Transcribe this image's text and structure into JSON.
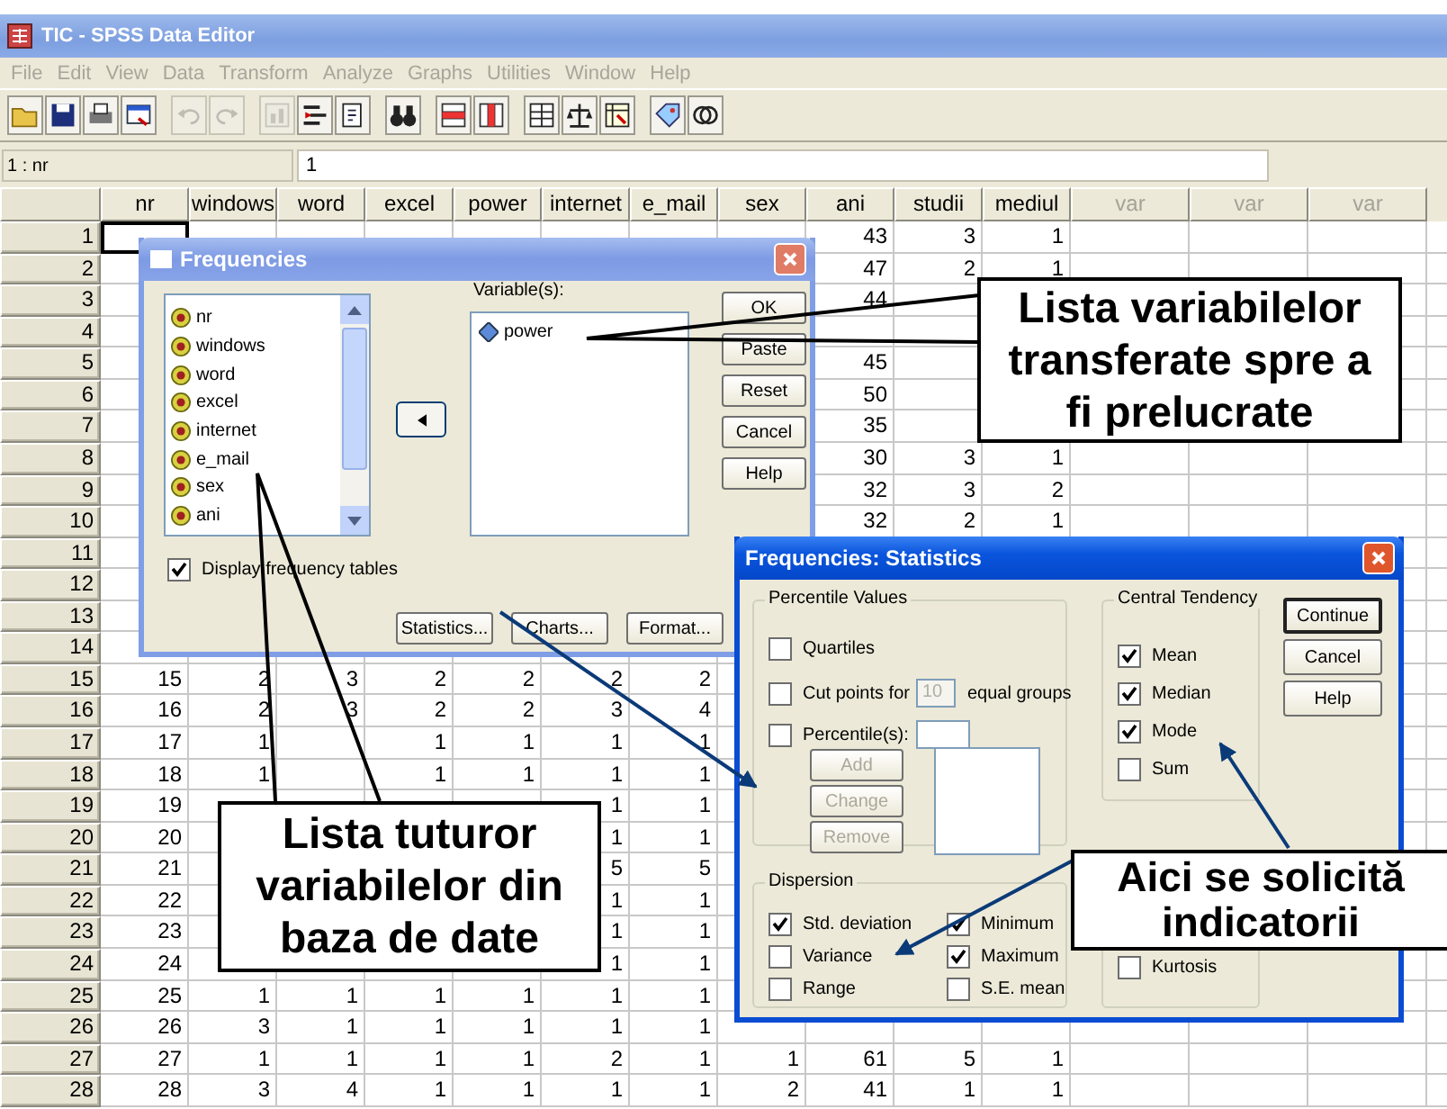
{
  "window": {
    "title": "TIC - SPSS Data Editor"
  },
  "menu": {
    "disabled": true,
    "items": [
      "File",
      "Edit",
      "View",
      "Data",
      "Transform",
      "Analyze",
      "Graphs",
      "Utilities",
      "Window",
      "Help"
    ]
  },
  "toolbar": [
    {
      "disabled": false
    },
    {
      "disabled": false
    },
    {
      "disabled": false
    },
    {
      "disabled": false
    },
    {
      "disabled": true
    },
    {
      "disabled": true
    },
    {
      "disabled": true
    },
    {
      "disabled": false
    },
    {
      "disabled": false
    },
    {
      "disabled": false
    },
    {
      "disabled": false
    },
    {
      "disabled": false
    },
    {
      "disabled": false
    },
    {
      "disabled": false
    },
    {
      "disabled": false
    },
    {
      "disabled": false
    },
    {
      "disabled": false
    }
  ],
  "cell_editor": {
    "reference": "1 : nr",
    "value": "1"
  },
  "columns": [
    {
      "label": "nr",
      "defined": true
    },
    {
      "label": "windows",
      "defined": true
    },
    {
      "label": "word",
      "defined": true
    },
    {
      "label": "excel",
      "defined": true
    },
    {
      "label": "power",
      "defined": true
    },
    {
      "label": "internet",
      "defined": true
    },
    {
      "label": "e_mail",
      "defined": true
    },
    {
      "label": "sex",
      "defined": true
    },
    {
      "label": "ani",
      "defined": true
    },
    {
      "label": "studii",
      "defined": true
    },
    {
      "label": "mediul",
      "defined": true
    },
    {
      "label": "var",
      "defined": false
    },
    {
      "label": "var",
      "defined": false
    },
    {
      "label": "var",
      "defined": false
    }
  ],
  "rows": [
    {
      "label": "1",
      "active": true,
      "cells": [
        null,
        null,
        null,
        null,
        null,
        null,
        null,
        null,
        "43",
        "3",
        "1",
        null,
        null,
        null
      ]
    },
    {
      "label": "2",
      "active": false,
      "cells": [
        null,
        null,
        null,
        null,
        null,
        null,
        null,
        null,
        "47",
        "2",
        "1",
        null,
        null,
        null
      ]
    },
    {
      "label": "3",
      "active": false,
      "cells": [
        null,
        null,
        null,
        null,
        null,
        null,
        null,
        null,
        "44",
        null,
        null,
        null,
        null,
        null
      ]
    },
    {
      "label": "4",
      "active": false,
      "cells": [
        null,
        null,
        null,
        null,
        null,
        null,
        null,
        null,
        null,
        null,
        null,
        null,
        null,
        null
      ]
    },
    {
      "label": "5",
      "active": false,
      "cells": [
        null,
        null,
        null,
        null,
        null,
        null,
        null,
        null,
        "45",
        null,
        null,
        null,
        null,
        null
      ]
    },
    {
      "label": "6",
      "active": false,
      "cells": [
        null,
        null,
        null,
        null,
        null,
        null,
        null,
        null,
        "50",
        null,
        null,
        null,
        null,
        null
      ]
    },
    {
      "label": "7",
      "active": false,
      "cells": [
        null,
        null,
        null,
        null,
        null,
        null,
        null,
        null,
        "35",
        null,
        null,
        null,
        null,
        null
      ]
    },
    {
      "label": "8",
      "active": false,
      "cells": [
        null,
        null,
        null,
        null,
        null,
        null,
        null,
        null,
        "30",
        "3",
        "1",
        null,
        null,
        null
      ]
    },
    {
      "label": "9",
      "active": false,
      "cells": [
        null,
        null,
        null,
        null,
        null,
        null,
        null,
        null,
        "32",
        "3",
        "2",
        null,
        null,
        null
      ]
    },
    {
      "label": "10",
      "active": false,
      "cells": [
        null,
        null,
        null,
        null,
        null,
        null,
        null,
        null,
        "32",
        "2",
        "1",
        null,
        null,
        null
      ]
    },
    {
      "label": "11",
      "active": false,
      "cells": [
        null,
        null,
        null,
        null,
        null,
        null,
        null,
        null,
        null,
        null,
        null,
        null,
        null,
        null
      ]
    },
    {
      "label": "12",
      "active": false,
      "cells": [
        null,
        null,
        null,
        null,
        null,
        null,
        null,
        null,
        null,
        null,
        null,
        null,
        null,
        null
      ]
    },
    {
      "label": "13",
      "active": false,
      "cells": [
        null,
        null,
        null,
        null,
        null,
        null,
        null,
        null,
        null,
        null,
        null,
        null,
        null,
        null
      ]
    },
    {
      "label": "14",
      "active": false,
      "cells": [
        null,
        null,
        null,
        null,
        null,
        null,
        null,
        null,
        null,
        null,
        null,
        null,
        null,
        null
      ]
    },
    {
      "label": "15",
      "active": false,
      "cells": [
        "15",
        "2",
        "3",
        "2",
        "2",
        "2",
        "2",
        null,
        null,
        null,
        null,
        null,
        null,
        null
      ]
    },
    {
      "label": "16",
      "active": false,
      "cells": [
        "16",
        "2",
        "3",
        "2",
        "2",
        "3",
        "4",
        null,
        null,
        null,
        null,
        null,
        null,
        null
      ]
    },
    {
      "label": "17",
      "active": false,
      "cells": [
        "17",
        "1",
        null,
        "1",
        "1",
        "1",
        "1",
        null,
        null,
        null,
        null,
        null,
        null,
        null
      ]
    },
    {
      "label": "18",
      "active": false,
      "cells": [
        "18",
        "1",
        null,
        "1",
        "1",
        "1",
        "1",
        null,
        null,
        null,
        null,
        null,
        null,
        null
      ]
    },
    {
      "label": "19",
      "active": false,
      "cells": [
        "19",
        null,
        null,
        null,
        null,
        "1",
        "1",
        null,
        null,
        null,
        null,
        null,
        null,
        null
      ]
    },
    {
      "label": "20",
      "active": false,
      "cells": [
        "20",
        null,
        null,
        null,
        null,
        "1",
        "1",
        null,
        null,
        null,
        null,
        null,
        null,
        null
      ]
    },
    {
      "label": "21",
      "active": false,
      "cells": [
        "21",
        null,
        null,
        null,
        null,
        "5",
        "5",
        null,
        null,
        null,
        null,
        null,
        null,
        null
      ]
    },
    {
      "label": "22",
      "active": false,
      "cells": [
        "22",
        null,
        null,
        null,
        null,
        "1",
        "1",
        null,
        null,
        null,
        null,
        null,
        null,
        null
      ]
    },
    {
      "label": "23",
      "active": false,
      "cells": [
        "23",
        null,
        null,
        null,
        null,
        "1",
        "1",
        null,
        null,
        null,
        null,
        null,
        null,
        null
      ]
    },
    {
      "label": "24",
      "active": false,
      "cells": [
        "24",
        null,
        null,
        null,
        null,
        "1",
        "1",
        null,
        null,
        null,
        null,
        null,
        null,
        null
      ]
    },
    {
      "label": "25",
      "active": false,
      "cells": [
        "25",
        "1",
        "1",
        "1",
        "1",
        "1",
        "1",
        null,
        null,
        null,
        null,
        null,
        null,
        null
      ]
    },
    {
      "label": "26",
      "active": false,
      "cells": [
        "26",
        "3",
        "1",
        "1",
        "1",
        "1",
        "1",
        null,
        null,
        null,
        null,
        null,
        null,
        null
      ]
    },
    {
      "label": "27",
      "active": false,
      "cells": [
        "27",
        "1",
        "1",
        "1",
        "1",
        "2",
        "1",
        "1",
        "61",
        "5",
        "1",
        null,
        null,
        null
      ]
    },
    {
      "label": "28",
      "active": false,
      "cells": [
        "28",
        "3",
        "4",
        "1",
        "1",
        "1",
        "1",
        "2",
        "41",
        "1",
        "1",
        null,
        null,
        null
      ]
    }
  ],
  "frequencies_dialog": {
    "title": "Frequencies",
    "source_variables": [
      "nr",
      "windows",
      "word",
      "excel",
      "internet",
      "e_mail",
      "sex",
      "ani"
    ],
    "target_label": "Variable(s):",
    "target_variables": [
      "power"
    ],
    "buttons": [
      "OK",
      "Paste",
      "Reset",
      "Cancel",
      "Help"
    ],
    "display_tables": {
      "label": "Display frequency tables",
      "checked": true
    },
    "bottom_buttons": [
      "Statistics...",
      "Charts...",
      "Format..."
    ]
  },
  "statistics_dialog": {
    "title": "Frequencies: Statistics",
    "percentile": {
      "title": "Percentile Values",
      "quartiles": {
        "label": "Quartiles",
        "checked": false
      },
      "cut_points": {
        "label": "Cut points for",
        "value": "10",
        "suffix": "equal groups",
        "checked": false
      },
      "percentiles": {
        "label": "Percentile(s):",
        "checked": false
      },
      "buttons": [
        {
          "label": "Add",
          "disabled": true
        },
        {
          "label": "Change",
          "disabled": true
        },
        {
          "label": "Remove",
          "disabled": true
        }
      ]
    },
    "central_tendency": {
      "title": "Central Tendency",
      "options": [
        {
          "label": "Mean",
          "checked": true
        },
        {
          "label": "Median",
          "checked": true
        },
        {
          "label": "Mode",
          "checked": true
        },
        {
          "label": "Sum",
          "checked": false
        }
      ]
    },
    "buttons": [
      {
        "label": "Continue",
        "default": true
      },
      {
        "label": "Cancel",
        "default": false
      },
      {
        "label": "Help",
        "default": false
      }
    ],
    "dispersion": {
      "title": "Dispersion",
      "options": [
        {
          "label": "Std. deviation",
          "checked": true
        },
        {
          "label": "Minimum",
          "checked": true
        },
        {
          "label": "Variance",
          "checked": false
        },
        {
          "label": "Maximum",
          "checked": true
        },
        {
          "label": "Range",
          "checked": false
        },
        {
          "label": "S.E. mean",
          "checked": false
        }
      ]
    },
    "distribution": {
      "options": [
        {
          "label": "Kurtosis",
          "checked": false
        }
      ]
    }
  },
  "callouts": [
    {
      "text": "Lista variabilelor transferate spre a fi prelucrate"
    },
    {
      "text": "Lista tuturor variabilelor din baza de date"
    },
    {
      "text": "Aici se solicită indicatorii"
    }
  ]
}
